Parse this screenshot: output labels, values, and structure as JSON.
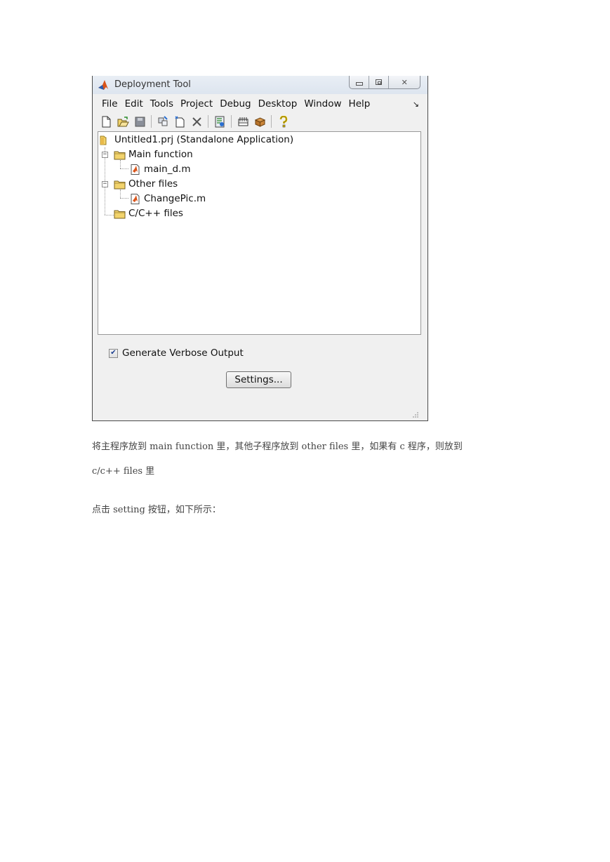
{
  "window": {
    "title": "Deployment Tool",
    "controls": {
      "close": "✕"
    }
  },
  "menubar": {
    "items": [
      "File",
      "Edit",
      "Tools",
      "Project",
      "Debug",
      "Desktop",
      "Window",
      "Help"
    ],
    "dock_glyph": "↘"
  },
  "toolbar": {
    "icons": [
      "new-file-icon",
      "open-folder-icon",
      "save-icon",
      "add-files-icon",
      "new-item-icon",
      "delete-icon",
      "build-icon",
      "package-icon",
      "box-icon",
      "help-icon"
    ]
  },
  "tree": {
    "root": "Untitled1.prj (Standalone Application)",
    "main_function": "Main function",
    "main_file": "main_d.m",
    "other_files": "Other files",
    "other_file": "ChangePic.m",
    "c_files": "C/C++ files",
    "expanded_glyph": "−"
  },
  "options": {
    "verbose_label": "Generate Verbose Output",
    "verbose_checked": true,
    "check_glyph": "✔",
    "settings_label": "Settings..."
  },
  "document": {
    "line1": "将主程序放到 main function 里，其他子程序放到 other files 里，如果有 c 程序，则放到",
    "line2": "c/c++ files 里",
    "line3": "点击 setting 按钮，如下所示："
  },
  "colors": {
    "folder": "#f2d36b",
    "matlab_orange": "#d9541a",
    "help_yellow": "#e6c200"
  }
}
